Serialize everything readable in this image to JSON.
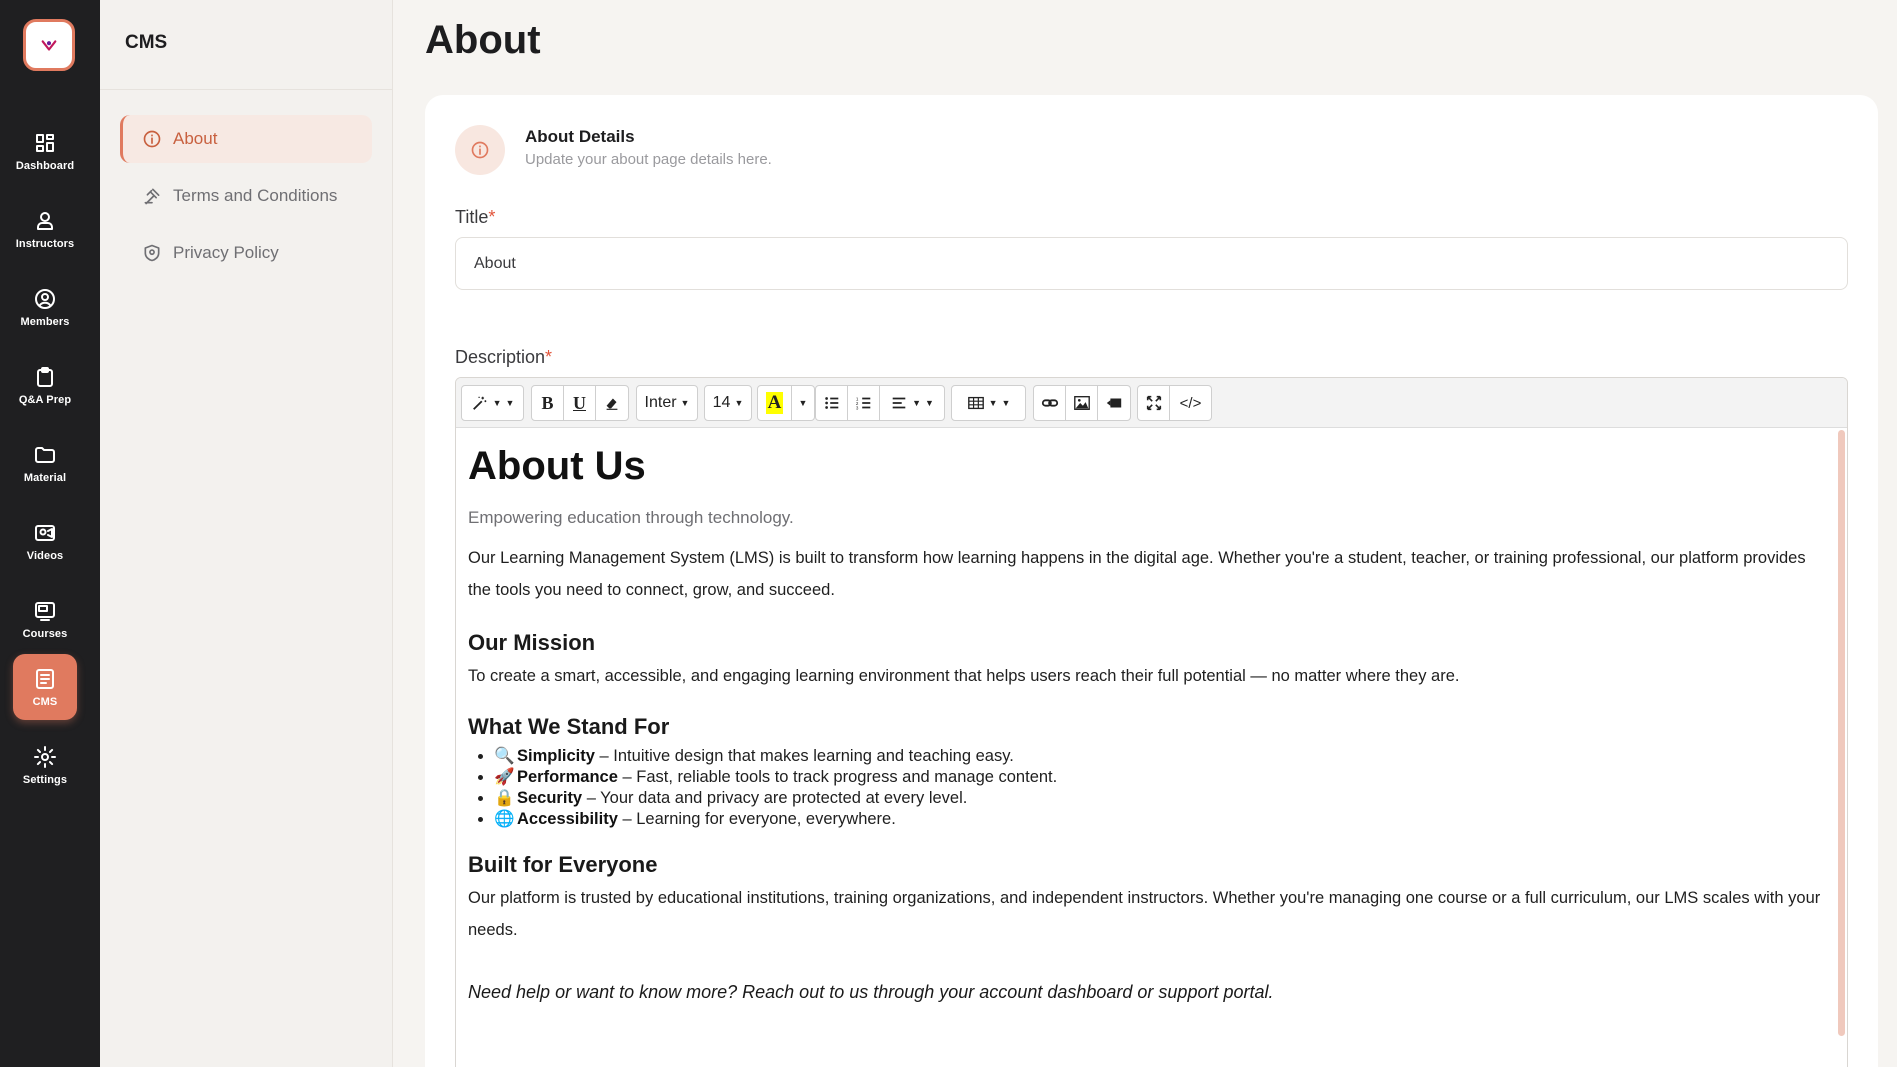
{
  "rail": {
    "items": [
      {
        "label": "Dashboard",
        "icon": "dashboard-icon"
      },
      {
        "label": "Instructors",
        "icon": "instructors-icon"
      },
      {
        "label": "Members",
        "icon": "members-icon"
      },
      {
        "label": "Q&A Prep",
        "icon": "clipboard-icon"
      },
      {
        "label": "Material",
        "icon": "folder-icon"
      },
      {
        "label": "Videos",
        "icon": "video-icon"
      },
      {
        "label": "Courses",
        "icon": "courses-icon"
      },
      {
        "label": "CMS",
        "icon": "cms-icon"
      },
      {
        "label": "Settings",
        "icon": "settings-icon"
      }
    ],
    "active": "CMS"
  },
  "subbar": {
    "title": "CMS",
    "items": [
      {
        "label": "About",
        "icon": "info-icon"
      },
      {
        "label": "Terms and Conditions",
        "icon": "gavel-icon"
      },
      {
        "label": "Privacy Policy",
        "icon": "shield-icon"
      }
    ],
    "active": "About"
  },
  "page": {
    "title": "About",
    "section_title": "About Details",
    "section_subtitle": "Update your about page details here.",
    "title_label": "Title",
    "title_value": "About",
    "description_label": "Description",
    "required_mark": "*"
  },
  "toolbar": {
    "font_name": "Inter",
    "font_size": "14",
    "bold": "B",
    "underline": "U",
    "highlight": "A",
    "code_view": "</>"
  },
  "content": {
    "h1": "About Us",
    "lead": "Empowering education through technology.",
    "intro": "Our Learning Management System (LMS) is built to transform how learning happens in the digital age. Whether you're a student, teacher, or training professional, our platform provides the tools you need to connect, grow, and succeed.",
    "mission_heading": "Our Mission",
    "mission_text": "To create a smart, accessible, and engaging learning environment that helps users reach their full potential — no matter where they are.",
    "values_heading": "What We Stand For",
    "values": [
      {
        "emoji": "🔍",
        "term": "Simplicity",
        "desc": " – Intuitive design that makes learning and teaching easy."
      },
      {
        "emoji": "🚀",
        "term": "Performance",
        "desc": " – Fast, reliable tools to track progress and manage content."
      },
      {
        "emoji": "🔒",
        "term": "Security",
        "desc": " – Your data and privacy are protected at every level."
      },
      {
        "emoji": "🌐",
        "term": "Accessibility",
        "desc": " – Learning for everyone, everywhere."
      }
    ],
    "everyone_heading": "Built for Everyone",
    "everyone_text": "Our platform is trusted by educational institutions, training organizations, and independent instructors. Whether you're managing one course or a full curriculum, our LMS scales with your needs.",
    "closing": "Need help or want to know more? Reach out to us through your account dashboard or support portal."
  },
  "colors": {
    "accent": "#e07a5f",
    "rail_bg": "#1f1f21",
    "page_bg": "#f6f4f1"
  }
}
